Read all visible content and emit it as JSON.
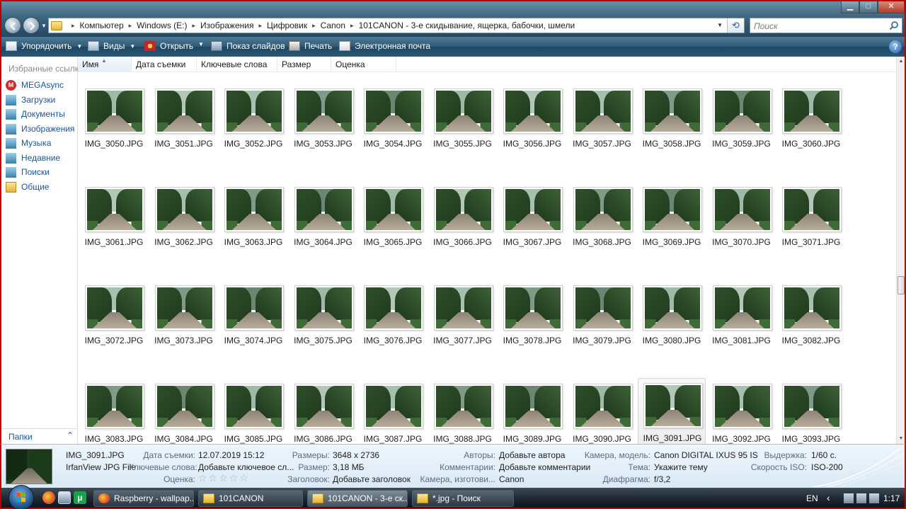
{
  "window": {
    "controls": {
      "minimize": "▁",
      "maximize": "□",
      "close": "✕"
    }
  },
  "address": {
    "crumbs": [
      "Компьютер",
      "Windows (E:)",
      "Изображения",
      "Цифровик",
      "Canon",
      "101CANON - 3-е скидывание, ящерка, бабочки, шмели"
    ],
    "separator": "▸",
    "search_placeholder": "Поиск"
  },
  "toolbar": {
    "organize": "Упорядочить",
    "views": "Виды",
    "open": "Открыть",
    "slideshow": "Показ слайдов",
    "print": "Печать",
    "email": "Электронная почта",
    "help": "?"
  },
  "sidebar": {
    "title": "Избранные ссылки",
    "items": [
      {
        "label": "MEGAsync",
        "icon": "mega-icon",
        "color": "#d9272e"
      },
      {
        "label": "Загрузки",
        "icon": "downloads-icon",
        "color": "#4a8fb6"
      },
      {
        "label": "Документы",
        "icon": "documents-icon",
        "color": "#4a8fb6"
      },
      {
        "label": "Изображения",
        "icon": "pictures-icon",
        "color": "#4a8fb6"
      },
      {
        "label": "Музыка",
        "icon": "music-icon",
        "color": "#4a8fb6"
      },
      {
        "label": "Недавние",
        "icon": "recent-icon",
        "color": "#4a8fb6"
      },
      {
        "label": "Поиски",
        "icon": "searches-icon",
        "color": "#4a8fb6"
      },
      {
        "label": "Общие",
        "icon": "shared-folder-icon",
        "color": "#e2b23a"
      }
    ],
    "folders_label": "Папки"
  },
  "columns": [
    "Имя",
    "Дата съемки",
    "Ключевые слова",
    "Размер",
    "Оценка"
  ],
  "files": [
    "IMG_3050.JPG",
    "IMG_3051.JPG",
    "IMG_3052.JPG",
    "IMG_3053.JPG",
    "IMG_3054.JPG",
    "IMG_3055.JPG",
    "IMG_3056.JPG",
    "IMG_3057.JPG",
    "IMG_3058.JPG",
    "IMG_3059.JPG",
    "IMG_3060.JPG",
    "IMG_3061.JPG",
    "IMG_3062.JPG",
    "IMG_3063.JPG",
    "IMG_3064.JPG",
    "IMG_3065.JPG",
    "IMG_3066.JPG",
    "IMG_3067.JPG",
    "IMG_3068.JPG",
    "IMG_3069.JPG",
    "IMG_3070.JPG",
    "IMG_3071.JPG",
    "IMG_3072.JPG",
    "IMG_3073.JPG",
    "IMG_3074.JPG",
    "IMG_3075.JPG",
    "IMG_3076.JPG",
    "IMG_3077.JPG",
    "IMG_3078.JPG",
    "IMG_3079.JPG",
    "IMG_3080.JPG",
    "IMG_3081.JPG",
    "IMG_3082.JPG",
    "IMG_3083.JPG",
    "IMG_3084.JPG",
    "IMG_3085.JPG",
    "IMG_3086.JPG",
    "IMG_3087.JPG",
    "IMG_3088.JPG",
    "IMG_3089.JPG",
    "IMG_3090.JPG",
    "IMG_3091.JPG",
    "IMG_3092.JPG",
    "IMG_3093.JPG"
  ],
  "selected_file": "IMG_3091.JPG",
  "details": {
    "filename": "IMG_3091.JPG",
    "filetype": "IrfanView JPG File",
    "date_label": "Дата съемки:",
    "date_value": "12.07.2019 15:12",
    "keywords_label": "Ключевые слова:",
    "keywords_value": "Добавьте ключевое сл...",
    "rating_label": "Оценка:",
    "stars": "☆☆☆☆☆",
    "dims_label": "Размеры:",
    "dims_value": "3648 x 2736",
    "size_label": "Размер:",
    "size_value": "3,18 МБ",
    "title_label": "Заголовок:",
    "title_value": "Добавьте заголовок",
    "authors_label": "Авторы:",
    "authors_value": "Добавьте автора",
    "comments_label": "Комментарии:",
    "comments_value": "Добавьте комментарии",
    "maker_label": "Камера, изготови...",
    "maker_value": "Canon",
    "model_label": "Камера, модель:",
    "model_value": "Canon DIGITAL IXUS 95 IS",
    "subject_label": "Тема:",
    "subject_value": "Укажите тему",
    "aperture_label": "Диафрагма:",
    "aperture_value": "f/3,2",
    "exposure_label": "Выдержка:",
    "exposure_value": "1/60 с.",
    "iso_label": "Скорость ISO:",
    "iso_value": "ISO-200"
  },
  "taskbar": {
    "tasks": [
      {
        "label": "Raspberry - wallpap...",
        "icon": "firefox-icon"
      },
      {
        "label": "101CANON",
        "icon": "folder-icon"
      },
      {
        "label": "101CANON - 3-е ск...",
        "icon": "folder-icon"
      },
      {
        "label": "*.jpg - Поиск",
        "icon": "search-folder-icon"
      }
    ],
    "lang": "EN",
    "tray_chevron": "‹",
    "clock": "1:17"
  }
}
